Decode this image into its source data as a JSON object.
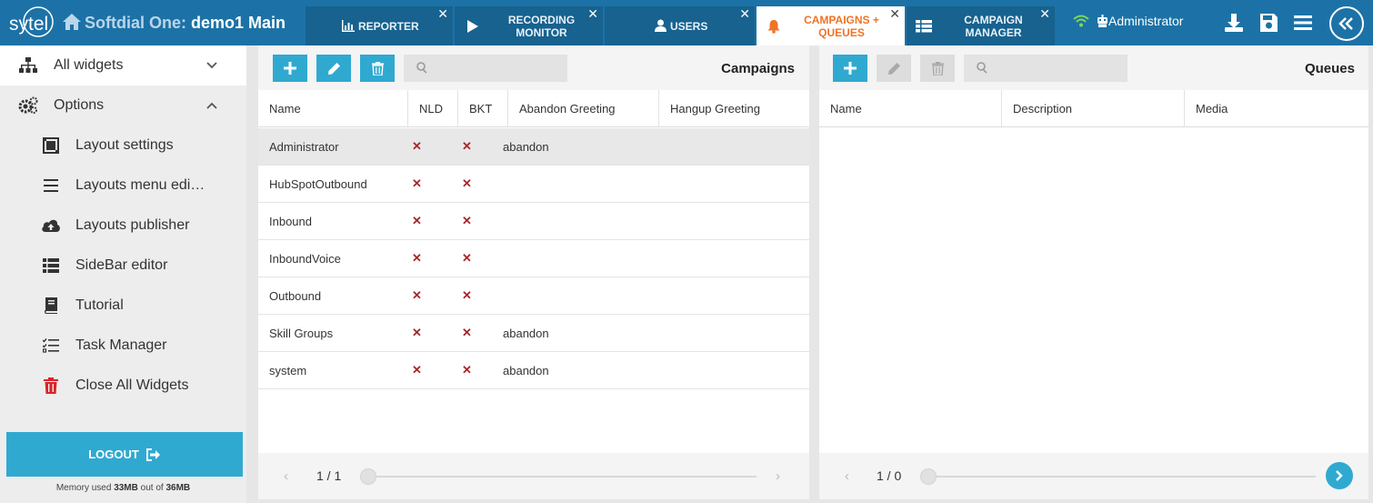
{
  "header": {
    "logo_text": "sytel",
    "app_name": "Softdial One:",
    "layout_name": "demo1 Main",
    "tabs": [
      {
        "label": "REPORTER",
        "icon": "bar-chart-icon"
      },
      {
        "label": "RECORDING MONITOR",
        "icon": "play-icon"
      },
      {
        "label": "USERS",
        "icon": "user-icon"
      },
      {
        "label": "CAMPAIGNS + QUEUES",
        "icon": "bell-icon",
        "active": true
      },
      {
        "label": "CAMPAIGN MANAGER",
        "icon": "table-list-icon"
      }
    ],
    "close_glyph": "✕",
    "user": "Administrator",
    "icons": [
      "wifi-icon",
      "robot-icon",
      "download-icon",
      "save-icon",
      "menu-icon",
      "collapse-left-icon"
    ]
  },
  "sidebar": {
    "items": [
      {
        "label": "All widgets",
        "icon": "sitemap-icon",
        "chevron": "down"
      },
      {
        "label": "Options",
        "icon": "cogs-icon",
        "chevron": "up"
      },
      {
        "label": "Layout settings",
        "icon": "layout-icon"
      },
      {
        "label": "Layouts menu edi…",
        "icon": "bars-icon"
      },
      {
        "label": "Layouts publisher",
        "icon": "cloud-upload-icon"
      },
      {
        "label": "SideBar editor",
        "icon": "list-icon"
      },
      {
        "label": "Tutorial",
        "icon": "book-icon"
      },
      {
        "label": "Task Manager",
        "icon": "tasks-icon"
      },
      {
        "label": "Close All Widgets",
        "icon": "trash-icon"
      }
    ],
    "logout_label": "LOGOUT",
    "memory": {
      "prefix": "Memory used",
      "used": "33MB",
      "mid": "out of",
      "total": "36MB"
    }
  },
  "campaigns": {
    "title": "Campaigns",
    "search_placeholder": "",
    "columns": [
      "Name",
      "NLD",
      "BKT",
      "Abandon Greeting",
      "Hangup Greeting"
    ],
    "rows": [
      {
        "name": "Administrator",
        "nld": "✕",
        "bkt": "✕",
        "abandon": "abandon",
        "hangup": ""
      },
      {
        "name": "HubSpotOutbound",
        "nld": "✕",
        "bkt": "✕",
        "abandon": "",
        "hangup": ""
      },
      {
        "name": "Inbound",
        "nld": "✕",
        "bkt": "✕",
        "abandon": "",
        "hangup": ""
      },
      {
        "name": "InboundVoice",
        "nld": "✕",
        "bkt": "✕",
        "abandon": "",
        "hangup": ""
      },
      {
        "name": "Outbound",
        "nld": "✕",
        "bkt": "✕",
        "abandon": "",
        "hangup": ""
      },
      {
        "name": "Skill Groups",
        "nld": "✕",
        "bkt": "✕",
        "abandon": "abandon",
        "hangup": ""
      },
      {
        "name": "system",
        "nld": "✕",
        "bkt": "✕",
        "abandon": "abandon",
        "hangup": ""
      }
    ],
    "selected_row": 0,
    "pager": {
      "prev": "‹",
      "text": "1 / 1",
      "next": "›"
    }
  },
  "queues": {
    "title": "Queues",
    "search_placeholder": "",
    "columns": [
      "Name",
      "Description",
      "Media"
    ],
    "rows": [],
    "pager": {
      "prev": "‹",
      "text": "1 / 0"
    }
  },
  "colors": {
    "header": "#1c72a6",
    "tab": "#17628f",
    "active_tab_text": "#f07327",
    "accent": "#30a9d1",
    "x_mark": "#a8262b",
    "close_widgets": "#d9232a"
  }
}
